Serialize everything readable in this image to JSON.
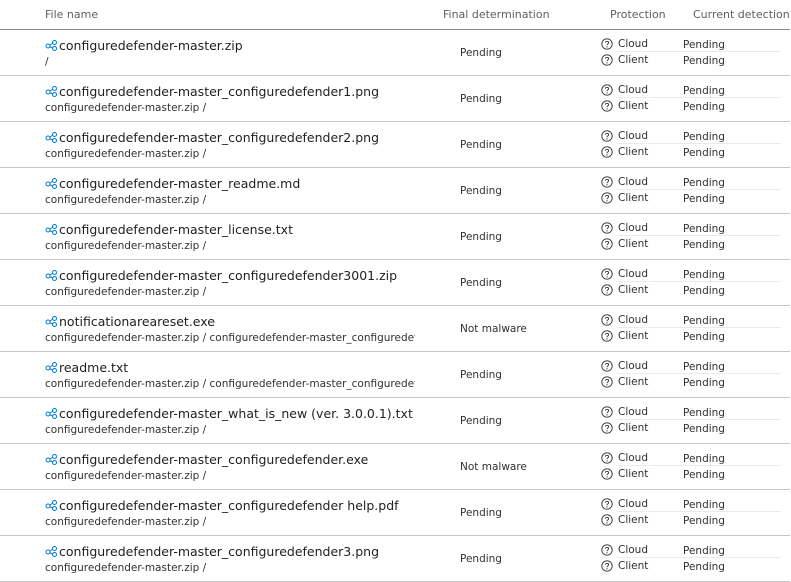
{
  "header": {
    "file_name": "File name",
    "final_determination": "Final determination",
    "protection": "Protection",
    "current_detection": "Current detection"
  },
  "colors": {
    "accent": "#0078d4",
    "border": "#c8c6c4",
    "text": "#323130"
  },
  "icons": {
    "file": "share-nodes-icon",
    "status": "question-circle-icon"
  },
  "rows": [
    {
      "name": "configuredefender-master.zip",
      "path": "/",
      "final": "Pending",
      "cloud": "Cloud",
      "client": "Client",
      "cloud_det": "Pending",
      "client_det": "Pending"
    },
    {
      "name": "configuredefender-master_configuredefender1.png",
      "path": "configuredefender-master.zip /",
      "final": "Pending",
      "cloud": "Cloud",
      "client": "Client",
      "cloud_det": "Pending",
      "client_det": "Pending"
    },
    {
      "name": "configuredefender-master_configuredefender2.png",
      "path": "configuredefender-master.zip /",
      "final": "Pending",
      "cloud": "Cloud",
      "client": "Client",
      "cloud_det": "Pending",
      "client_det": "Pending"
    },
    {
      "name": "configuredefender-master_readme.md",
      "path": "configuredefender-master.zip /",
      "final": "Pending",
      "cloud": "Cloud",
      "client": "Client",
      "cloud_det": "Pending",
      "client_det": "Pending"
    },
    {
      "name": "configuredefender-master_license.txt",
      "path": "configuredefender-master.zip /",
      "final": "Pending",
      "cloud": "Cloud",
      "client": "Client",
      "cloud_det": "Pending",
      "client_det": "Pending"
    },
    {
      "name": "configuredefender-master_configuredefender3001.zip",
      "path": "configuredefender-master.zip /",
      "final": "Pending",
      "cloud": "Cloud",
      "client": "Client",
      "cloud_det": "Pending",
      "client_det": "Pending"
    },
    {
      "name": "notificationareareset.exe",
      "path": "configuredefender-master.zip / configuredefender-master_configuredefen...",
      "final": "Not malware",
      "cloud": "Cloud",
      "client": "Client",
      "cloud_det": "Pending",
      "client_det": "Pending"
    },
    {
      "name": "readme.txt",
      "path": "configuredefender-master.zip / configuredefender-master_configuredefen...",
      "final": "Pending",
      "cloud": "Cloud",
      "client": "Client",
      "cloud_det": "Pending",
      "client_det": "Pending"
    },
    {
      "name": "configuredefender-master_what_is_new (ver. 3.0.0.1).txt",
      "path": "configuredefender-master.zip /",
      "final": "Pending",
      "cloud": "Cloud",
      "client": "Client",
      "cloud_det": "Pending",
      "client_det": "Pending"
    },
    {
      "name": "configuredefender-master_configuredefender.exe",
      "path": "configuredefender-master.zip /",
      "final": "Not malware",
      "cloud": "Cloud",
      "client": "Client",
      "cloud_det": "Pending",
      "client_det": "Pending"
    },
    {
      "name": "configuredefender-master_configuredefender help.pdf",
      "path": "configuredefender-master.zip /",
      "final": "Pending",
      "cloud": "Cloud",
      "client": "Client",
      "cloud_det": "Pending",
      "client_det": "Pending"
    },
    {
      "name": "configuredefender-master_configuredefender3.png",
      "path": "configuredefender-master.zip /",
      "final": "Pending",
      "cloud": "Cloud",
      "client": "Client",
      "cloud_det": "Pending",
      "client_det": "Pending"
    }
  ]
}
